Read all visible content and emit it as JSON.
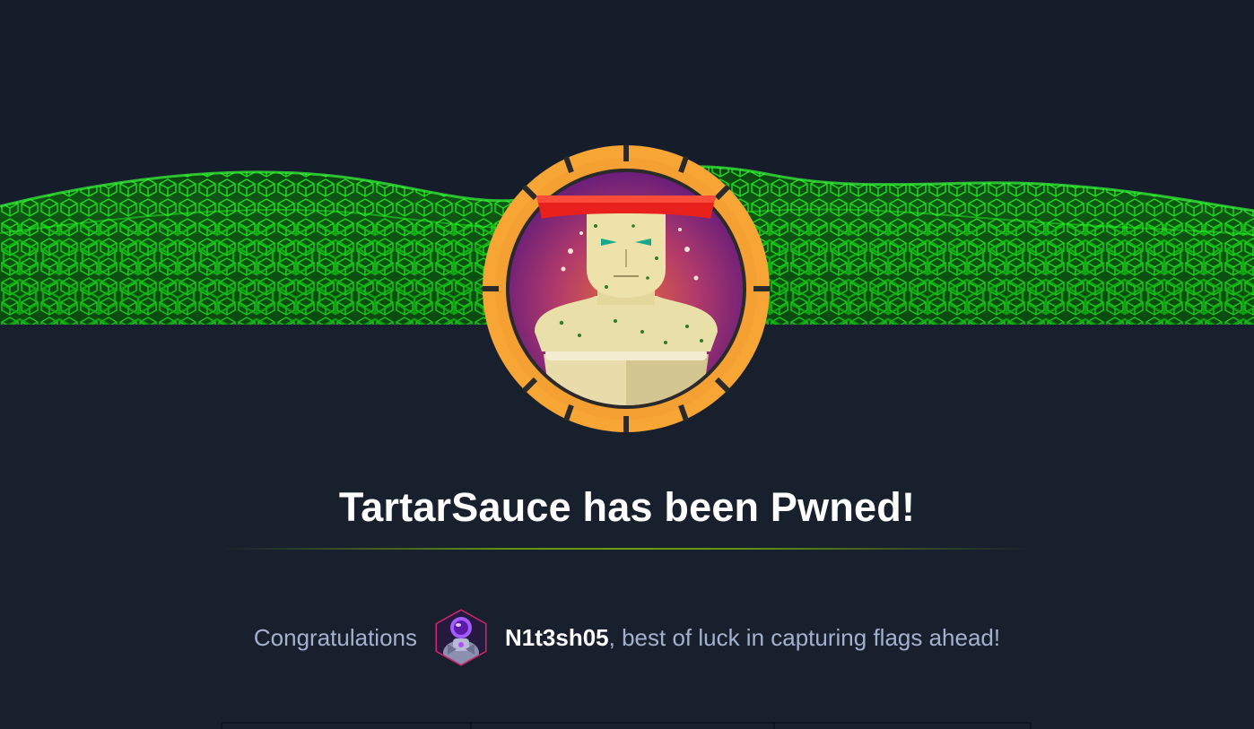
{
  "machine": {
    "name": "TartarSauce",
    "badge_icon": "tartarsauce-machine-avatar"
  },
  "title": "TartarSauce has been Pwned!",
  "congratulations": {
    "prefix": "Congratulations",
    "username": "N1t3sh05",
    "suffix": ", best of luck in capturing flags ahead!",
    "avatar_icon": "astronaut-avatar"
  },
  "colors": {
    "background": "#18202e",
    "accent_green": "#9fef00",
    "badge_ring": "#f7a534",
    "text_muted": "#a4b1cd",
    "text_white": "#ffffff"
  }
}
